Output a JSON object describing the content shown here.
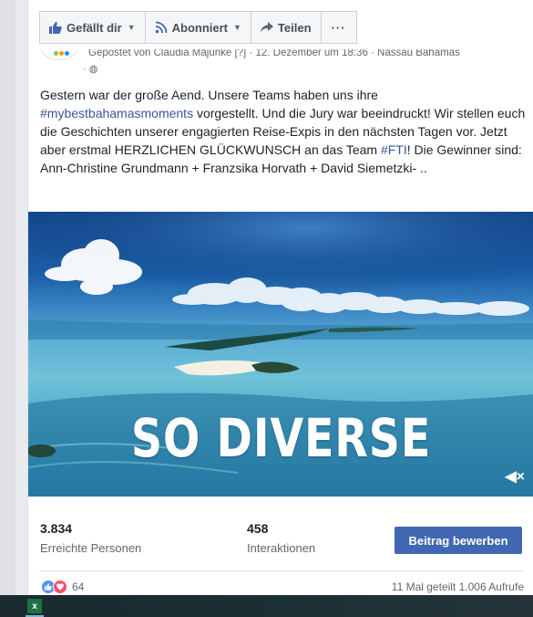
{
  "actionbar": {
    "like_label": "Gefällt dir",
    "subscribe_label": "Abonniert",
    "share_label": "Teilen",
    "more_label": "···"
  },
  "post": {
    "byline": "Gepostet von Claudia Majunke [?] · 12. Dezember um 18:36 · Nassau Bahamas",
    "text_1": "Gestern war der große Aend. Unsere Teams haben uns ihre ",
    "hashtag_1": "#mybestbahamasmoments",
    "text_2": " vorgestellt. Und die Jury war beeindruckt! Wir stellen euch die Geschichten unserer engagierten Reise-Expis in den nächsten Tagen vor. Jetzt aber erstmal HERZLICHEN GLÜCKWUNSCH an das Team ",
    "hashtag_2": "#FTI",
    "text_3": "! Die Gewinner sind: Ann-Christine Grundmann + Franzsika Horvath + David Siemetzki- .."
  },
  "media": {
    "overlay_title": "SO DIVERSE",
    "mute_glyph": "◀×"
  },
  "stats": {
    "reached_value": "3.834",
    "reached_label": "Erreichte Personen",
    "interactions_value": "458",
    "interactions_label": "Interaktionen",
    "boost_label": "Beitrag bewerben"
  },
  "footer": {
    "reaction_count": "64",
    "shares_views": "11 Mal geteilt  1.006 Aufrufe"
  },
  "taskbar": {
    "excel_glyph": "x"
  },
  "colors": {
    "facebook_blue": "#4267b2",
    "link_blue": "#365899",
    "like_blue": "#5890ff",
    "love_red": "#f25268"
  },
  "icons": [
    "thumbs-up-icon",
    "rss-feed-icon",
    "share-arrow-icon",
    "globe-icon",
    "mute-icon",
    "like-reaction-icon",
    "love-reaction-icon",
    "excel-icon"
  ]
}
